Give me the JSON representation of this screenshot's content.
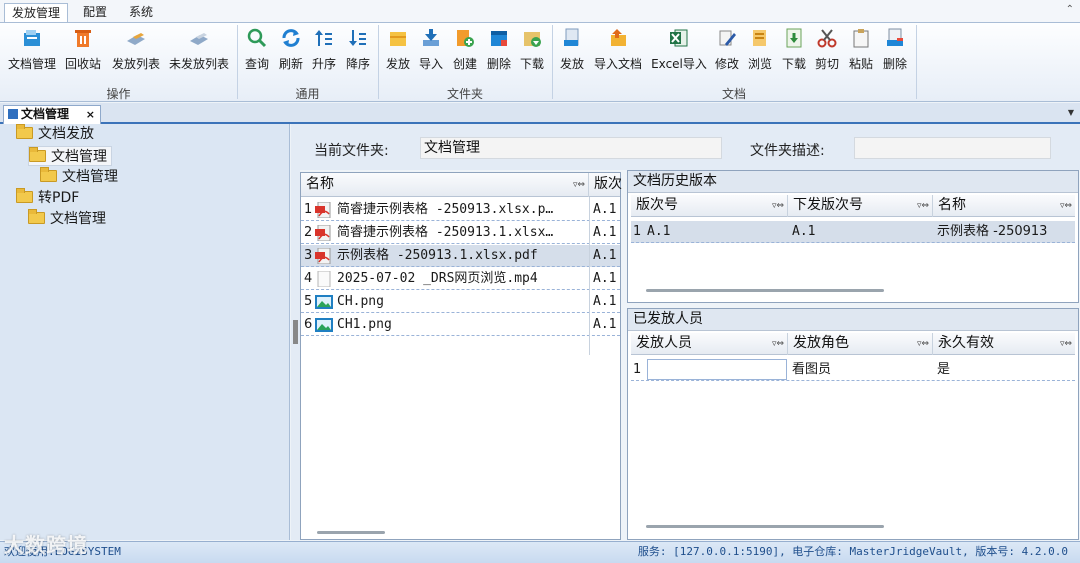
{
  "menu": {
    "tabs": [
      "发放管理",
      "配置",
      "系统"
    ],
    "collapse_glyph": "⌃"
  },
  "ribbon": {
    "groups": {
      "op": "操作",
      "common": "通用",
      "folder": "文件夹",
      "doc": "文档"
    },
    "buttons": {
      "doc_mgmt": "文档管理",
      "recycle": "回收站",
      "release_list": "发放列表",
      "unreleased_list": "未发放列表",
      "query": "查询",
      "refresh": "刷新",
      "asc": "升序",
      "desc": "降序",
      "f_release": "发放",
      "f_import": "导入",
      "f_create": "创建",
      "f_delete": "删除",
      "f_download": "下载",
      "d_release": "发放",
      "import_doc": "导入文档",
      "excel_import": "Excel导入",
      "modify": "修改",
      "browse": "浏览",
      "d_download": "下载",
      "cut": "剪切",
      "paste": "粘贴",
      "d_delete": "删除"
    }
  },
  "doc_tab": {
    "label": "文档管理",
    "close": "×",
    "menu_glyph": "▼"
  },
  "tree": {
    "root1": "文档发放",
    "child1": "文档管理",
    "child1_1": "文档管理",
    "root2": "转PDF",
    "child2": "文档管理"
  },
  "folder_bar": {
    "current_label": "当前文件夹:",
    "current_value": "文档管理",
    "desc_label": "文件夹描述:",
    "desc_value": ""
  },
  "file_grid": {
    "columns": {
      "name": "名称",
      "version": "版次"
    },
    "filter_glyph": "▿⇔",
    "rows": [
      {
        "n": "1",
        "icon": "pdf-icon",
        "name": "简睿捷示例表格 -250913.xlsx.p…",
        "ver": "A.1"
      },
      {
        "n": "2",
        "icon": "pdf-icon",
        "name": "简睿捷示例表格 -250913.1.xlsx…",
        "ver": "A.1"
      },
      {
        "n": "3",
        "icon": "pdf-icon",
        "name": "示例表格 -250913.1.xlsx.pdf",
        "ver": "A.1"
      },
      {
        "n": "4",
        "icon": "file-icon",
        "name": "2025-07-02 _DRS网页浏览.mp4",
        "ver": "A.1"
      },
      {
        "n": "5",
        "icon": "image-icon",
        "name": "CH.png",
        "ver": "A.1"
      },
      {
        "n": "6",
        "icon": "image-icon",
        "name": "CH1.png",
        "ver": "A.1"
      }
    ]
  },
  "history_panel": {
    "title": "文档历史版本",
    "columns": {
      "ver": "版次号",
      "issue": "下发版次号",
      "name": "名称"
    },
    "rows": [
      {
        "n": "1",
        "ver": "A.1",
        "issue": "A.1",
        "name": "示例表格 -250913"
      }
    ]
  },
  "issued_panel": {
    "title": "已发放人员",
    "columns": {
      "person": "发放人员",
      "role": "发放角色",
      "perm": "永久有效"
    },
    "rows": [
      {
        "n": "1",
        "person": "",
        "role": "看图员",
        "perm": "是"
      }
    ]
  },
  "status": {
    "left": "欢迎使用:LOGISYSTEM",
    "right": "服务: [127.0.0.1:5190], 电子仓库: MasterJridgeVault, 版本号: 4.2.0.0"
  },
  "watermark": "大数跨境",
  "colors": {
    "accent": "#3b73b9",
    "tree_bg": "#dbe6f3",
    "selected_row": "#d5deea"
  }
}
